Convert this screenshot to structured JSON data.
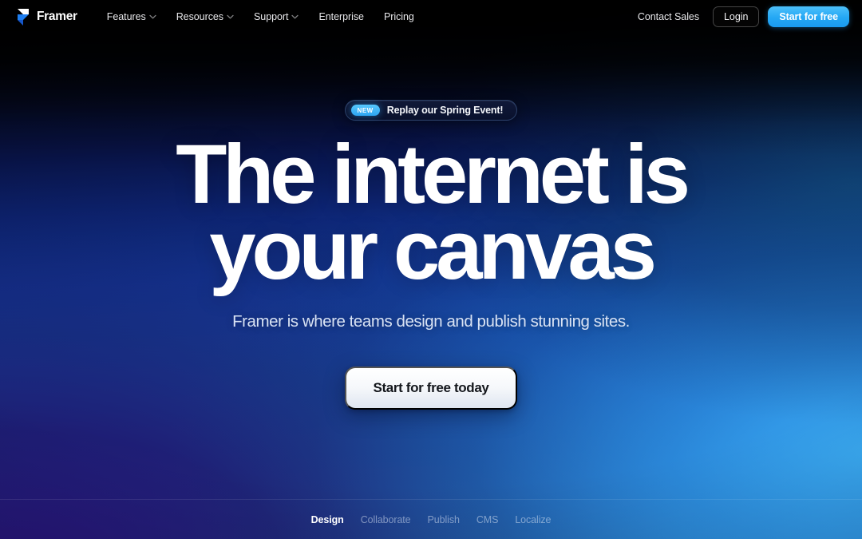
{
  "brand": {
    "name": "Framer",
    "logo_icon": "framer-logo-icon"
  },
  "nav": {
    "links": [
      {
        "label": "Features",
        "icon": "chevron-down-icon",
        "has_chevron": true
      },
      {
        "label": "Resources",
        "icon": "chevron-down-icon",
        "has_chevron": true
      },
      {
        "label": "Support",
        "icon": "chevron-down-icon",
        "has_chevron": true
      },
      {
        "label": "Enterprise",
        "icon": "",
        "has_chevron": false
      },
      {
        "label": "Pricing",
        "icon": "",
        "has_chevron": false
      }
    ],
    "contact_sales": "Contact Sales",
    "login": "Login",
    "start_for_free": "Start for free"
  },
  "hero": {
    "badge": {
      "chip": "NEW",
      "text": "Replay our Spring Event!"
    },
    "headline_line1": "The internet is",
    "headline_line2": "your canvas",
    "subheadline": "Framer is where teams design and publish stunning sites.",
    "cta": "Start for free today"
  },
  "tabs": [
    {
      "label": "Design",
      "active": true
    },
    {
      "label": "Collaborate",
      "active": false
    },
    {
      "label": "Publish",
      "active": false
    },
    {
      "label": "CMS",
      "active": false
    },
    {
      "label": "Localize",
      "active": false
    }
  ],
  "colors": {
    "accent_blue": "#24a7f4",
    "chip_blue": "#2da6f2",
    "bg_dark": "#05060d",
    "bg_indigo": "#150a4f",
    "bg_royal": "#1b4fad",
    "bg_cyan": "#2b8fe8",
    "cta_text": "#14171c"
  }
}
